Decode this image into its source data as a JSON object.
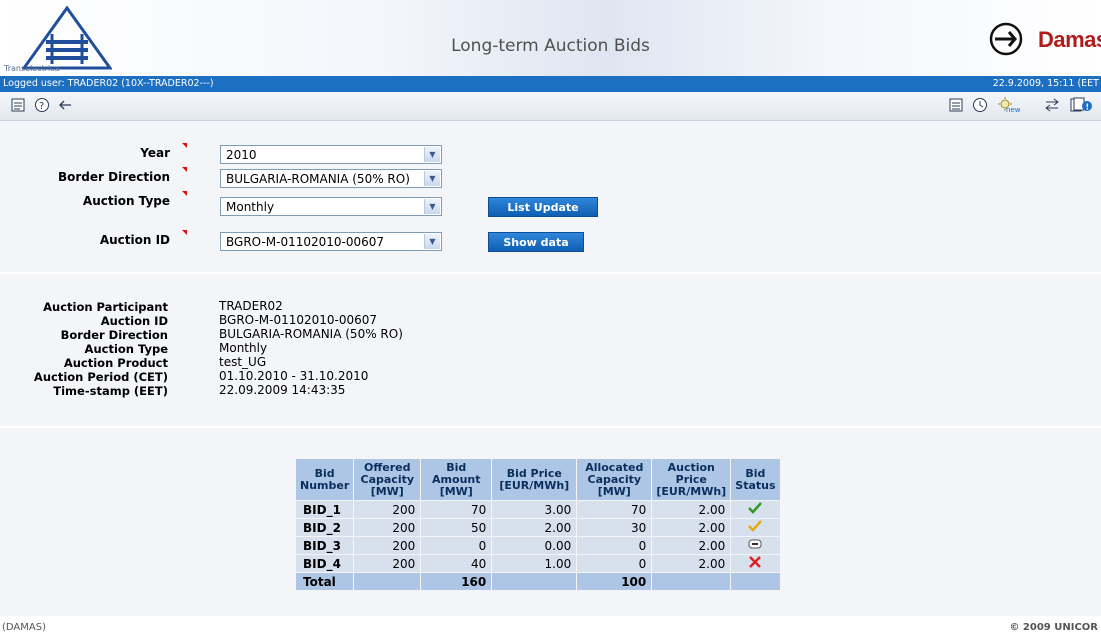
{
  "header": {
    "title": "Long-term Auction Bids",
    "logo_left_caption": "Transelectrica",
    "logo_right_text": "Damas"
  },
  "status": {
    "user": "Logged user: TRADER02 (10X--TRADER02---)",
    "datetime": "22.9.2009, 15:11  (EET"
  },
  "toolbar": {
    "left_icons": [
      "report-icon",
      "help-icon",
      "back-arrow-icon"
    ],
    "right_icons": [
      "list-icon",
      "clock-icon",
      "new-icon",
      "exchange-icon",
      "documents-info-icon"
    ]
  },
  "form": {
    "year": {
      "label": "Year",
      "value": "2010"
    },
    "border_direction": {
      "label": "Border Direction",
      "value": "BULGARIA-ROMANIA (50% RO)"
    },
    "auction_type": {
      "label": "Auction Type",
      "value": "Monthly"
    },
    "auction_id": {
      "label": "Auction ID",
      "value": "BGRO-M-01102010-00607"
    },
    "list_update_label": "List Update",
    "show_data_label": "Show data"
  },
  "info": [
    {
      "label": "Auction Participant",
      "value": "TRADER02"
    },
    {
      "label": "Auction ID",
      "value": "BGRO-M-01102010-00607"
    },
    {
      "label": "Border Direction",
      "value": "BULGARIA-ROMANIA (50% RO)"
    },
    {
      "label": "Auction Type",
      "value": "Monthly"
    },
    {
      "label": "Auction Product",
      "value": "test_UG"
    },
    {
      "label": "Auction Period (CET)",
      "value": "01.10.2010 - 31.10.2010"
    },
    {
      "label": "Time-stamp (EET)",
      "value": "22.09.2009 14:43:35"
    }
  ],
  "table": {
    "headers": {
      "bid_number": [
        "Bid",
        "Number"
      ],
      "offered_capacity": [
        "Offered",
        "Capacity",
        "[MW]"
      ],
      "bid_amount": [
        "Bid",
        "Amount",
        "[MW]"
      ],
      "bid_price": [
        "Bid Price",
        "[EUR/MWh]"
      ],
      "allocated_capacity": [
        "Allocated",
        "Capacity",
        "[MW]"
      ],
      "auction_price": [
        "Auction",
        "Price",
        "[EUR/MWh]"
      ],
      "bid_status": [
        "Bid",
        "Status"
      ]
    },
    "rows": [
      {
        "bid": "BID_1",
        "offered": "200",
        "amount": "70",
        "price": "3.00",
        "allocated": "70",
        "auction_price": "2.00",
        "status": "accepted",
        "status_color": "#2e9b1f"
      },
      {
        "bid": "BID_2",
        "offered": "200",
        "amount": "50",
        "price": "2.00",
        "allocated": "30",
        "auction_price": "2.00",
        "status": "partially-accepted",
        "status_color": "#e6a817"
      },
      {
        "bid": "BID_3",
        "offered": "200",
        "amount": "0",
        "price": "0.00",
        "allocated": "0",
        "auction_price": "2.00",
        "status": "not-evaluated",
        "status_color": "#555555"
      },
      {
        "bid": "BID_4",
        "offered": "200",
        "amount": "40",
        "price": "1.00",
        "allocated": "0",
        "auction_price": "2.00",
        "status": "rejected",
        "status_color": "#e02020"
      }
    ],
    "total": {
      "label": "Total",
      "amount": "160",
      "allocated": "100"
    }
  },
  "footer": {
    "left": "(DAMAS)",
    "right": "© 2009 UNICOR"
  },
  "colors": {
    "statusbar": "#1d6fc2",
    "header_cell": "#aec6e6",
    "body_cell": "#d7e1ee",
    "button": "#1a6fc4"
  }
}
